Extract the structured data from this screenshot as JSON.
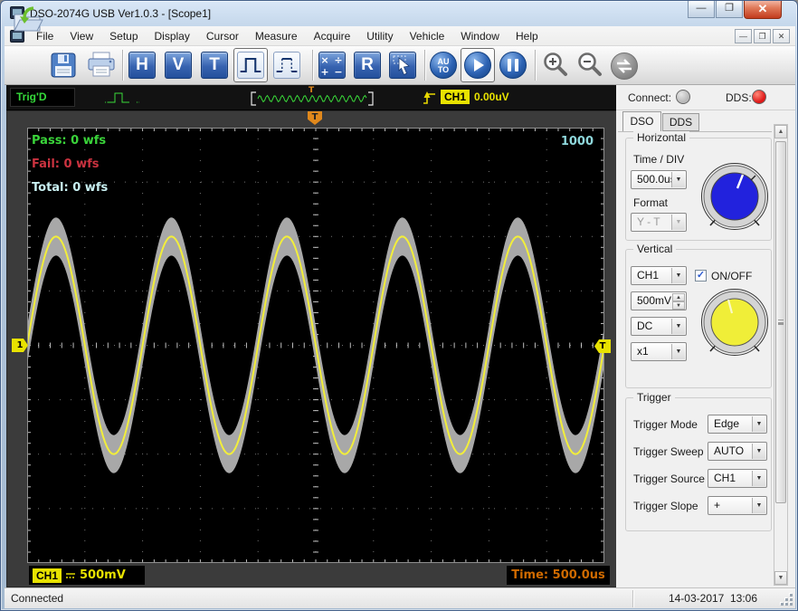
{
  "window": {
    "title": "DSO-2074G USB Ver1.0.3 - [Scope1]",
    "caption_buttons": {
      "minimize": "—",
      "maximize": "❐",
      "close": "✕"
    }
  },
  "menu": {
    "items": [
      "File",
      "View",
      "Setup",
      "Display",
      "Cursor",
      "Measure",
      "Acquire",
      "Utility",
      "Vehicle",
      "Window",
      "Help"
    ],
    "mdi_buttons": {
      "minimize": "—",
      "restore": "❐",
      "close": "✕"
    }
  },
  "toolbar": {
    "h_label": "H",
    "v_label": "V",
    "t_label": "T",
    "r_label": "R",
    "auto_line1": "AU",
    "auto_line2": "TO",
    "selected": [
      "pulse",
      "play"
    ]
  },
  "trig_bar": {
    "status": "Trig'D",
    "channel_badge": "CH1",
    "level": "0.00uV",
    "preview_marker": "T"
  },
  "connection": {
    "connect_label": "Connect:",
    "connect_color": "#b8b8b8",
    "dds_label": "DDS:",
    "dds_color": "#e01818"
  },
  "tabs": {
    "dso": "DSO",
    "dds": "DDS"
  },
  "horizontal": {
    "group_label": "Horizontal",
    "time_div_label": "Time / DIV",
    "time_div_value": "500.0us",
    "format_label": "Format",
    "format_value": "Y - T",
    "knob_color": "#2222dd"
  },
  "vertical": {
    "group_label": "Vertical",
    "channel_value": "CH1",
    "onoff_label": "ON/OFF",
    "onoff_checked": true,
    "volts_value": "500mV",
    "coupling_value": "DC",
    "probe_value": "x1",
    "knob_color": "#f0ee38"
  },
  "trigger": {
    "group_label": "Trigger",
    "rows": [
      {
        "label": "Trigger Mode",
        "value": "Edge"
      },
      {
        "label": "Trigger Sweep",
        "value": "AUTO"
      },
      {
        "label": "Trigger Source",
        "value": "CH1"
      },
      {
        "label": "Trigger Slope",
        "value": "+"
      }
    ]
  },
  "scope": {
    "pass": "Pass: 0 wfs",
    "fail": "Fail: 0 wfs",
    "total": "Total: 0 wfs",
    "buffer_depth": "1000",
    "marker_left": "1",
    "marker_right": "T",
    "marker_top": "T",
    "channel_badge": "CH1",
    "channel_scale": "500mV",
    "time_label": "Time: 500.0us",
    "colors": {
      "pass": "#3ad43a",
      "fail": "#cc3340",
      "total": "#c9f0f2",
      "buffer": "#8fd8dc",
      "time": "#cf6a00"
    }
  },
  "status_bar": {
    "text": "Connected",
    "datetime": "14-03-2017  13:06"
  },
  "chart_data": {
    "type": "line",
    "title": "CH1 sine waveform with pass/fail mask envelope",
    "volts_per_div": "500mV",
    "time_per_div": "500.0us",
    "amplitude_divs": 2,
    "period_divs": 2,
    "mask_halfheight_divs": 0.35,
    "visible_periods": 5,
    "grid": {
      "columns": 10,
      "rows": 8,
      "style": "dotted"
    },
    "trigger_level_div": 0,
    "trace_color": "#f2ee3a",
    "mask_color": "#a8a8a8"
  }
}
